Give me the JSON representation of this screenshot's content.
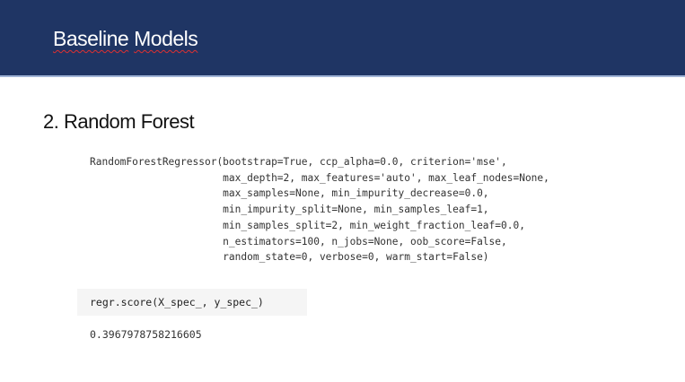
{
  "header": {
    "title_words": [
      "Baseline",
      "Models"
    ]
  },
  "section_title": "2. Random Forest",
  "model_repr_lines": [
    "RandomForestRegressor(bootstrap=True, ccp_alpha=0.0, criterion='mse',",
    "                      max_depth=2, max_features='auto', max_leaf_nodes=None,",
    "                      max_samples=None, min_impurity_decrease=0.0,",
    "                      min_impurity_split=None, min_samples_leaf=1,",
    "                      min_samples_split=2, min_weight_fraction_leaf=0.0,",
    "                      n_estimators=100, n_jobs=None, oob_score=False,",
    "                      random_state=0, verbose=0, warm_start=False)"
  ],
  "score_cell": {
    "code": "regr.score(X_spec_, y_spec_)",
    "output": "0.3967978758216605"
  }
}
